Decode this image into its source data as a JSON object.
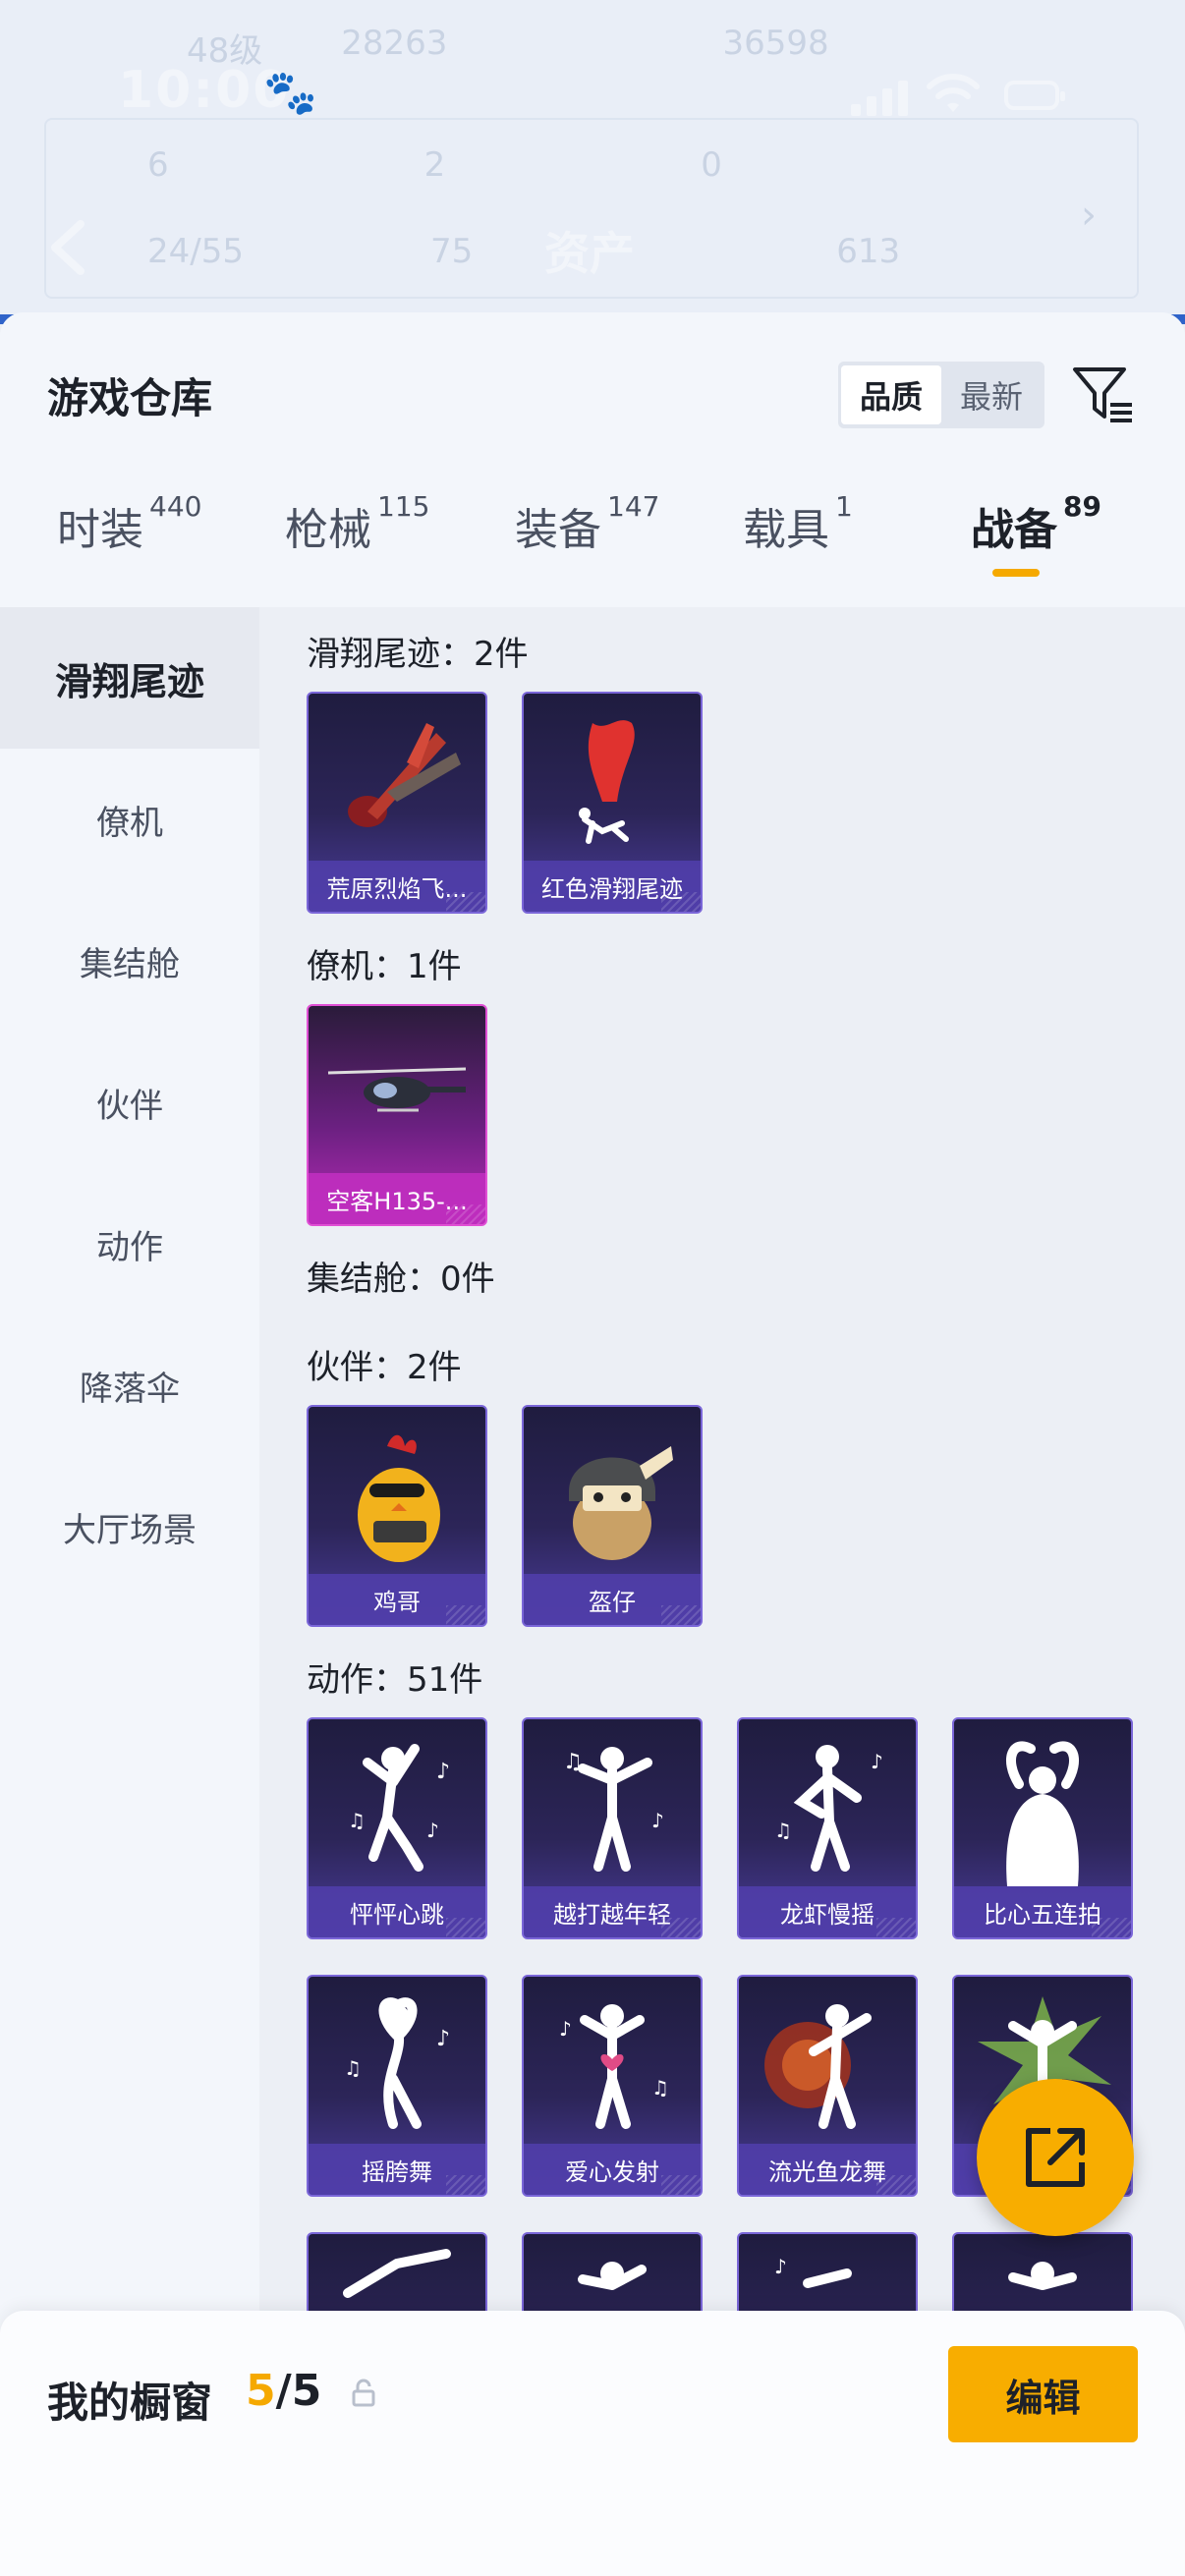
{
  "status_bar": {
    "time": "10:00"
  },
  "background": {
    "title": "资产",
    "row1": [
      "48级",
      "28263",
      "36598"
    ],
    "row2": [
      "6",
      "2",
      "0"
    ],
    "row3": [
      "24/55",
      "75",
      "613"
    ]
  },
  "sheet": {
    "title": "游戏仓库",
    "sort": {
      "options": [
        "品质",
        "最新"
      ],
      "active": "品质"
    }
  },
  "tabs": [
    {
      "label": "时装",
      "count": "440"
    },
    {
      "label": "枪械",
      "count": "115"
    },
    {
      "label": "装备",
      "count": "147"
    },
    {
      "label": "载具",
      "count": "1"
    },
    {
      "label": "战备",
      "count": "89"
    }
  ],
  "active_tab": "战备",
  "leftnav": [
    "滑翔尾迹",
    "僚机",
    "集结舱",
    "伙伴",
    "动作",
    "降落伞",
    "大厅场景"
  ],
  "sections": {
    "glide": {
      "title": "滑翔尾迹：2件",
      "items": [
        "荒原烈焰飞...",
        "红色滑翔尾迹"
      ]
    },
    "wingman": {
      "title": "僚机：1件",
      "items": [
        "空客H135-..."
      ]
    },
    "capsule": {
      "title": "集结舱：0件"
    },
    "partner": {
      "title": "伙伴：2件",
      "items": [
        "鸡哥",
        "盔仔"
      ]
    },
    "emote": {
      "title": "动作：51件",
      "items": [
        "怦怦心跳",
        "越打越年轻",
        "龙虾慢摇",
        "比心五连拍",
        "摇胯舞",
        "爱心发射",
        "流光鱼龙舞",
        ""
      ]
    }
  },
  "bottom": {
    "title": "我的橱窗",
    "count_current": "5",
    "count_sep": "/",
    "count_total": "5",
    "edit_label": "编辑"
  },
  "colors": {
    "accent": "#f8ad00",
    "card_purple": "#4a3c9a",
    "card_pink": "#b72bb6"
  }
}
